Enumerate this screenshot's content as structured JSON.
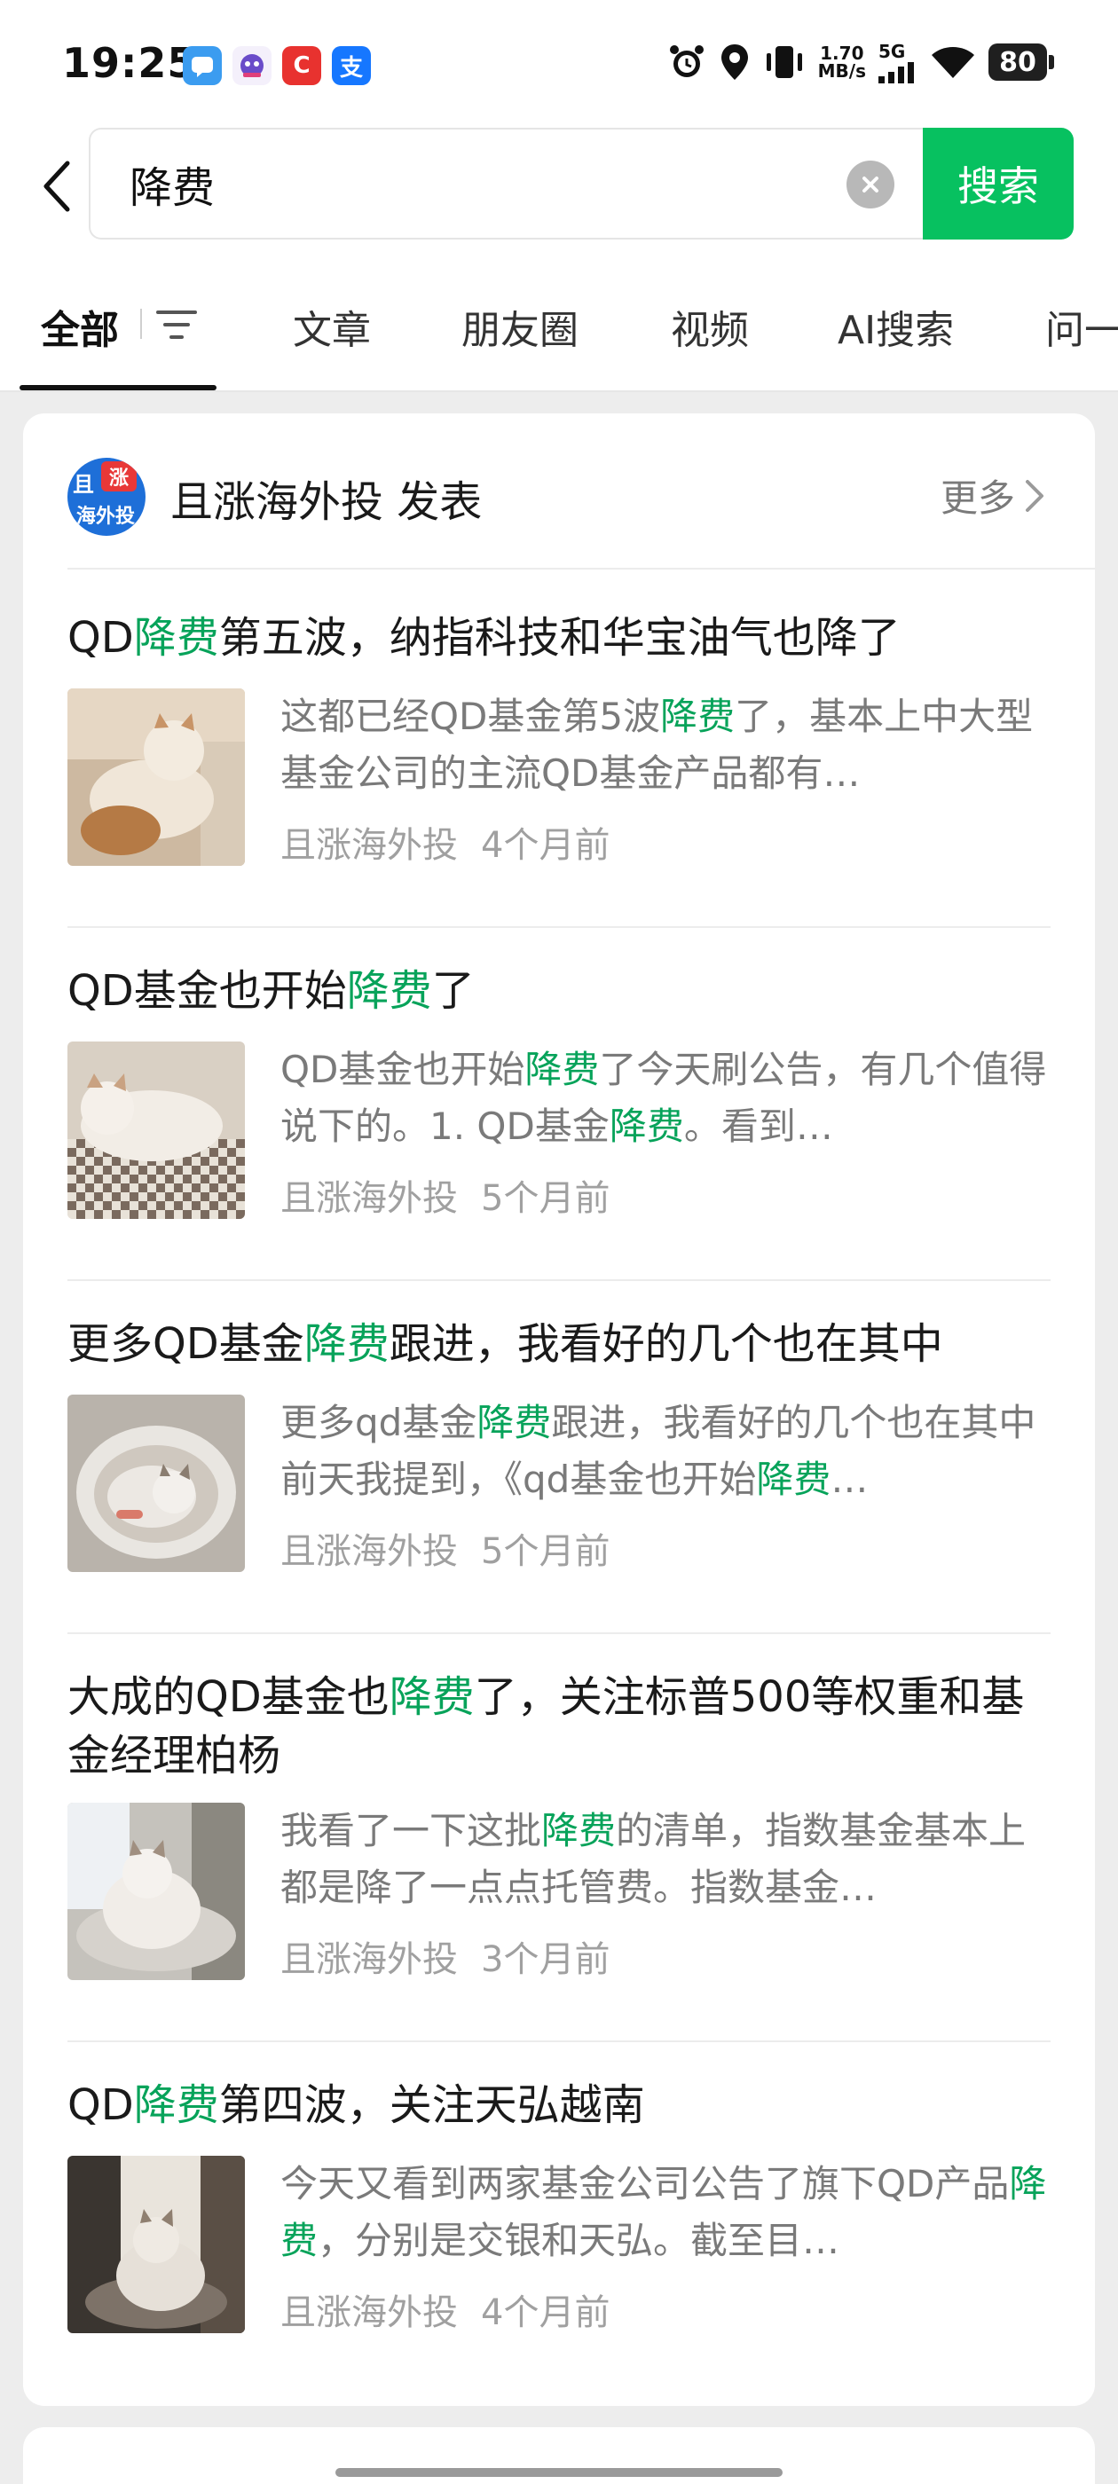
{
  "status_bar": {
    "time": "19:25",
    "net_speed_value": "1.70",
    "net_speed_unit": "MB/s",
    "network": "5G",
    "battery": "80",
    "app_icons": [
      "notes-app-icon",
      "mascot-app-icon",
      "c-app-icon",
      "alipay-app-icon"
    ],
    "app_icon_chars": {
      "c": "C",
      "alipay": "支"
    }
  },
  "search": {
    "query": "降费",
    "button_label": "搜索"
  },
  "tabs": [
    {
      "label": "全部",
      "active": true
    },
    {
      "label": "文章"
    },
    {
      "label": "朋友圈"
    },
    {
      "label": "视频"
    },
    {
      "label": "AI搜索"
    },
    {
      "label": "问一"
    }
  ],
  "account": {
    "avatar_top": "且",
    "avatar_badge": "涨",
    "avatar_bottom": "海外投",
    "name": "且涨海外投 发表",
    "more_label": "更多"
  },
  "articles": [
    {
      "title": [
        "QD",
        "降费",
        "第五波，纳指科技和华宝油气也降了"
      ],
      "snippet": [
        "这都已经QD基金第5波",
        "降费",
        "了，基本上中大型基金公司的主流QD基金产品都有…"
      ],
      "source": "且涨海外投",
      "time": "4个月前"
    },
    {
      "title": [
        "QD基金也开始",
        "降费",
        "了"
      ],
      "snippet": [
        "QD基金也开始",
        "降费",
        "了今天刷公告，有几个值得说下的。1. QD基金",
        "降费",
        "。看到…"
      ],
      "source": "且涨海外投",
      "time": "5个月前"
    },
    {
      "title": [
        "更多QD基金",
        "降费",
        "跟进，我看好的几个也在其中"
      ],
      "snippet": [
        "更多qd基金",
        "降费",
        "跟进，我看好的几个也在其中 前天我提到，《qd基金也开始",
        "降费",
        "…"
      ],
      "source": "且涨海外投",
      "time": "5个月前"
    },
    {
      "title": [
        "大成的QD基金也",
        "降费",
        "了，关注标普500等权重和基金经理柏杨"
      ],
      "snippet": [
        "我看了一下这批",
        "降费",
        "的清单，指数基金基本上都是降了一点点托管费。指数基金…"
      ],
      "source": "且涨海外投",
      "time": "3个月前"
    },
    {
      "title": [
        "QD",
        "降费",
        "第四波，关注天弘越南"
      ],
      "snippet": [
        "今天又看到两家基金公司公告了旗下QD产品",
        "降费",
        "，分别是交银和天弘。截至目…"
      ],
      "source": "且涨海外投",
      "time": "4个月前"
    }
  ],
  "colors": {
    "accent": "#07c160",
    "highlight": "#07a35a",
    "background": "#ededed"
  }
}
